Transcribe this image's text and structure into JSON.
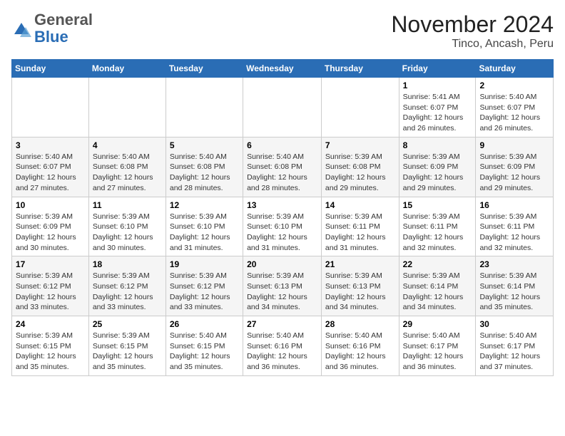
{
  "header": {
    "logo": {
      "general": "General",
      "blue": "Blue"
    },
    "title": "November 2024",
    "location": "Tinco, Ancash, Peru"
  },
  "days_of_week": [
    "Sunday",
    "Monday",
    "Tuesday",
    "Wednesday",
    "Thursday",
    "Friday",
    "Saturday"
  ],
  "weeks": [
    [
      {
        "day": "",
        "info": ""
      },
      {
        "day": "",
        "info": ""
      },
      {
        "day": "",
        "info": ""
      },
      {
        "day": "",
        "info": ""
      },
      {
        "day": "",
        "info": ""
      },
      {
        "day": "1",
        "info": "Sunrise: 5:41 AM\nSunset: 6:07 PM\nDaylight: 12 hours and 26 minutes."
      },
      {
        "day": "2",
        "info": "Sunrise: 5:40 AM\nSunset: 6:07 PM\nDaylight: 12 hours and 26 minutes."
      }
    ],
    [
      {
        "day": "3",
        "info": "Sunrise: 5:40 AM\nSunset: 6:07 PM\nDaylight: 12 hours and 27 minutes."
      },
      {
        "day": "4",
        "info": "Sunrise: 5:40 AM\nSunset: 6:08 PM\nDaylight: 12 hours and 27 minutes."
      },
      {
        "day": "5",
        "info": "Sunrise: 5:40 AM\nSunset: 6:08 PM\nDaylight: 12 hours and 28 minutes."
      },
      {
        "day": "6",
        "info": "Sunrise: 5:40 AM\nSunset: 6:08 PM\nDaylight: 12 hours and 28 minutes."
      },
      {
        "day": "7",
        "info": "Sunrise: 5:39 AM\nSunset: 6:08 PM\nDaylight: 12 hours and 29 minutes."
      },
      {
        "day": "8",
        "info": "Sunrise: 5:39 AM\nSunset: 6:09 PM\nDaylight: 12 hours and 29 minutes."
      },
      {
        "day": "9",
        "info": "Sunrise: 5:39 AM\nSunset: 6:09 PM\nDaylight: 12 hours and 29 minutes."
      }
    ],
    [
      {
        "day": "10",
        "info": "Sunrise: 5:39 AM\nSunset: 6:09 PM\nDaylight: 12 hours and 30 minutes."
      },
      {
        "day": "11",
        "info": "Sunrise: 5:39 AM\nSunset: 6:10 PM\nDaylight: 12 hours and 30 minutes."
      },
      {
        "day": "12",
        "info": "Sunrise: 5:39 AM\nSunset: 6:10 PM\nDaylight: 12 hours and 31 minutes."
      },
      {
        "day": "13",
        "info": "Sunrise: 5:39 AM\nSunset: 6:10 PM\nDaylight: 12 hours and 31 minutes."
      },
      {
        "day": "14",
        "info": "Sunrise: 5:39 AM\nSunset: 6:11 PM\nDaylight: 12 hours and 31 minutes."
      },
      {
        "day": "15",
        "info": "Sunrise: 5:39 AM\nSunset: 6:11 PM\nDaylight: 12 hours and 32 minutes."
      },
      {
        "day": "16",
        "info": "Sunrise: 5:39 AM\nSunset: 6:11 PM\nDaylight: 12 hours and 32 minutes."
      }
    ],
    [
      {
        "day": "17",
        "info": "Sunrise: 5:39 AM\nSunset: 6:12 PM\nDaylight: 12 hours and 33 minutes."
      },
      {
        "day": "18",
        "info": "Sunrise: 5:39 AM\nSunset: 6:12 PM\nDaylight: 12 hours and 33 minutes."
      },
      {
        "day": "19",
        "info": "Sunrise: 5:39 AM\nSunset: 6:12 PM\nDaylight: 12 hours and 33 minutes."
      },
      {
        "day": "20",
        "info": "Sunrise: 5:39 AM\nSunset: 6:13 PM\nDaylight: 12 hours and 34 minutes."
      },
      {
        "day": "21",
        "info": "Sunrise: 5:39 AM\nSunset: 6:13 PM\nDaylight: 12 hours and 34 minutes."
      },
      {
        "day": "22",
        "info": "Sunrise: 5:39 AM\nSunset: 6:14 PM\nDaylight: 12 hours and 34 minutes."
      },
      {
        "day": "23",
        "info": "Sunrise: 5:39 AM\nSunset: 6:14 PM\nDaylight: 12 hours and 35 minutes."
      }
    ],
    [
      {
        "day": "24",
        "info": "Sunrise: 5:39 AM\nSunset: 6:15 PM\nDaylight: 12 hours and 35 minutes."
      },
      {
        "day": "25",
        "info": "Sunrise: 5:39 AM\nSunset: 6:15 PM\nDaylight: 12 hours and 35 minutes."
      },
      {
        "day": "26",
        "info": "Sunrise: 5:40 AM\nSunset: 6:15 PM\nDaylight: 12 hours and 35 minutes."
      },
      {
        "day": "27",
        "info": "Sunrise: 5:40 AM\nSunset: 6:16 PM\nDaylight: 12 hours and 36 minutes."
      },
      {
        "day": "28",
        "info": "Sunrise: 5:40 AM\nSunset: 6:16 PM\nDaylight: 12 hours and 36 minutes."
      },
      {
        "day": "29",
        "info": "Sunrise: 5:40 AM\nSunset: 6:17 PM\nDaylight: 12 hours and 36 minutes."
      },
      {
        "day": "30",
        "info": "Sunrise: 5:40 AM\nSunset: 6:17 PM\nDaylight: 12 hours and 37 minutes."
      }
    ]
  ]
}
